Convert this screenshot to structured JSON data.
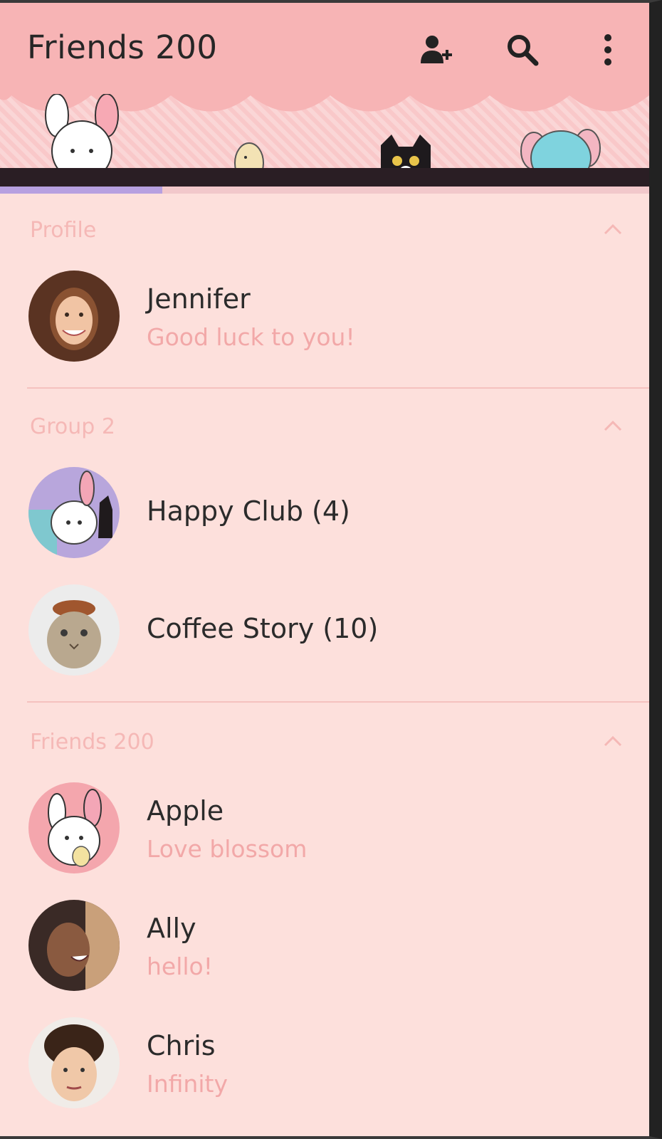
{
  "header": {
    "title": "Friends 200",
    "icons": [
      "add-friend-icon",
      "search-icon",
      "more-options-icon"
    ]
  },
  "sections": {
    "profile": {
      "title": "Profile",
      "rows": [
        {
          "name": "Jennifer",
          "status": "Good luck to you!"
        }
      ]
    },
    "groups": {
      "title": "Group 2",
      "rows": [
        {
          "name": "Happy Club (4)"
        },
        {
          "name": "Coffee Story (10)"
        }
      ]
    },
    "friends": {
      "title": "Friends 200",
      "rows": [
        {
          "name": "Apple",
          "status": "Love blossom"
        },
        {
          "name": "Ally",
          "status": "hello!"
        },
        {
          "name": "Chris",
          "status": "Infinity"
        }
      ]
    }
  },
  "colors": {
    "header_bg": "#f7b4b5",
    "page_bg": "#fde0dc",
    "section_title": "#f5b8b6",
    "status_text": "#f2a8a8",
    "name_text": "#2b2b2b",
    "progress": "#b7a0e0"
  }
}
